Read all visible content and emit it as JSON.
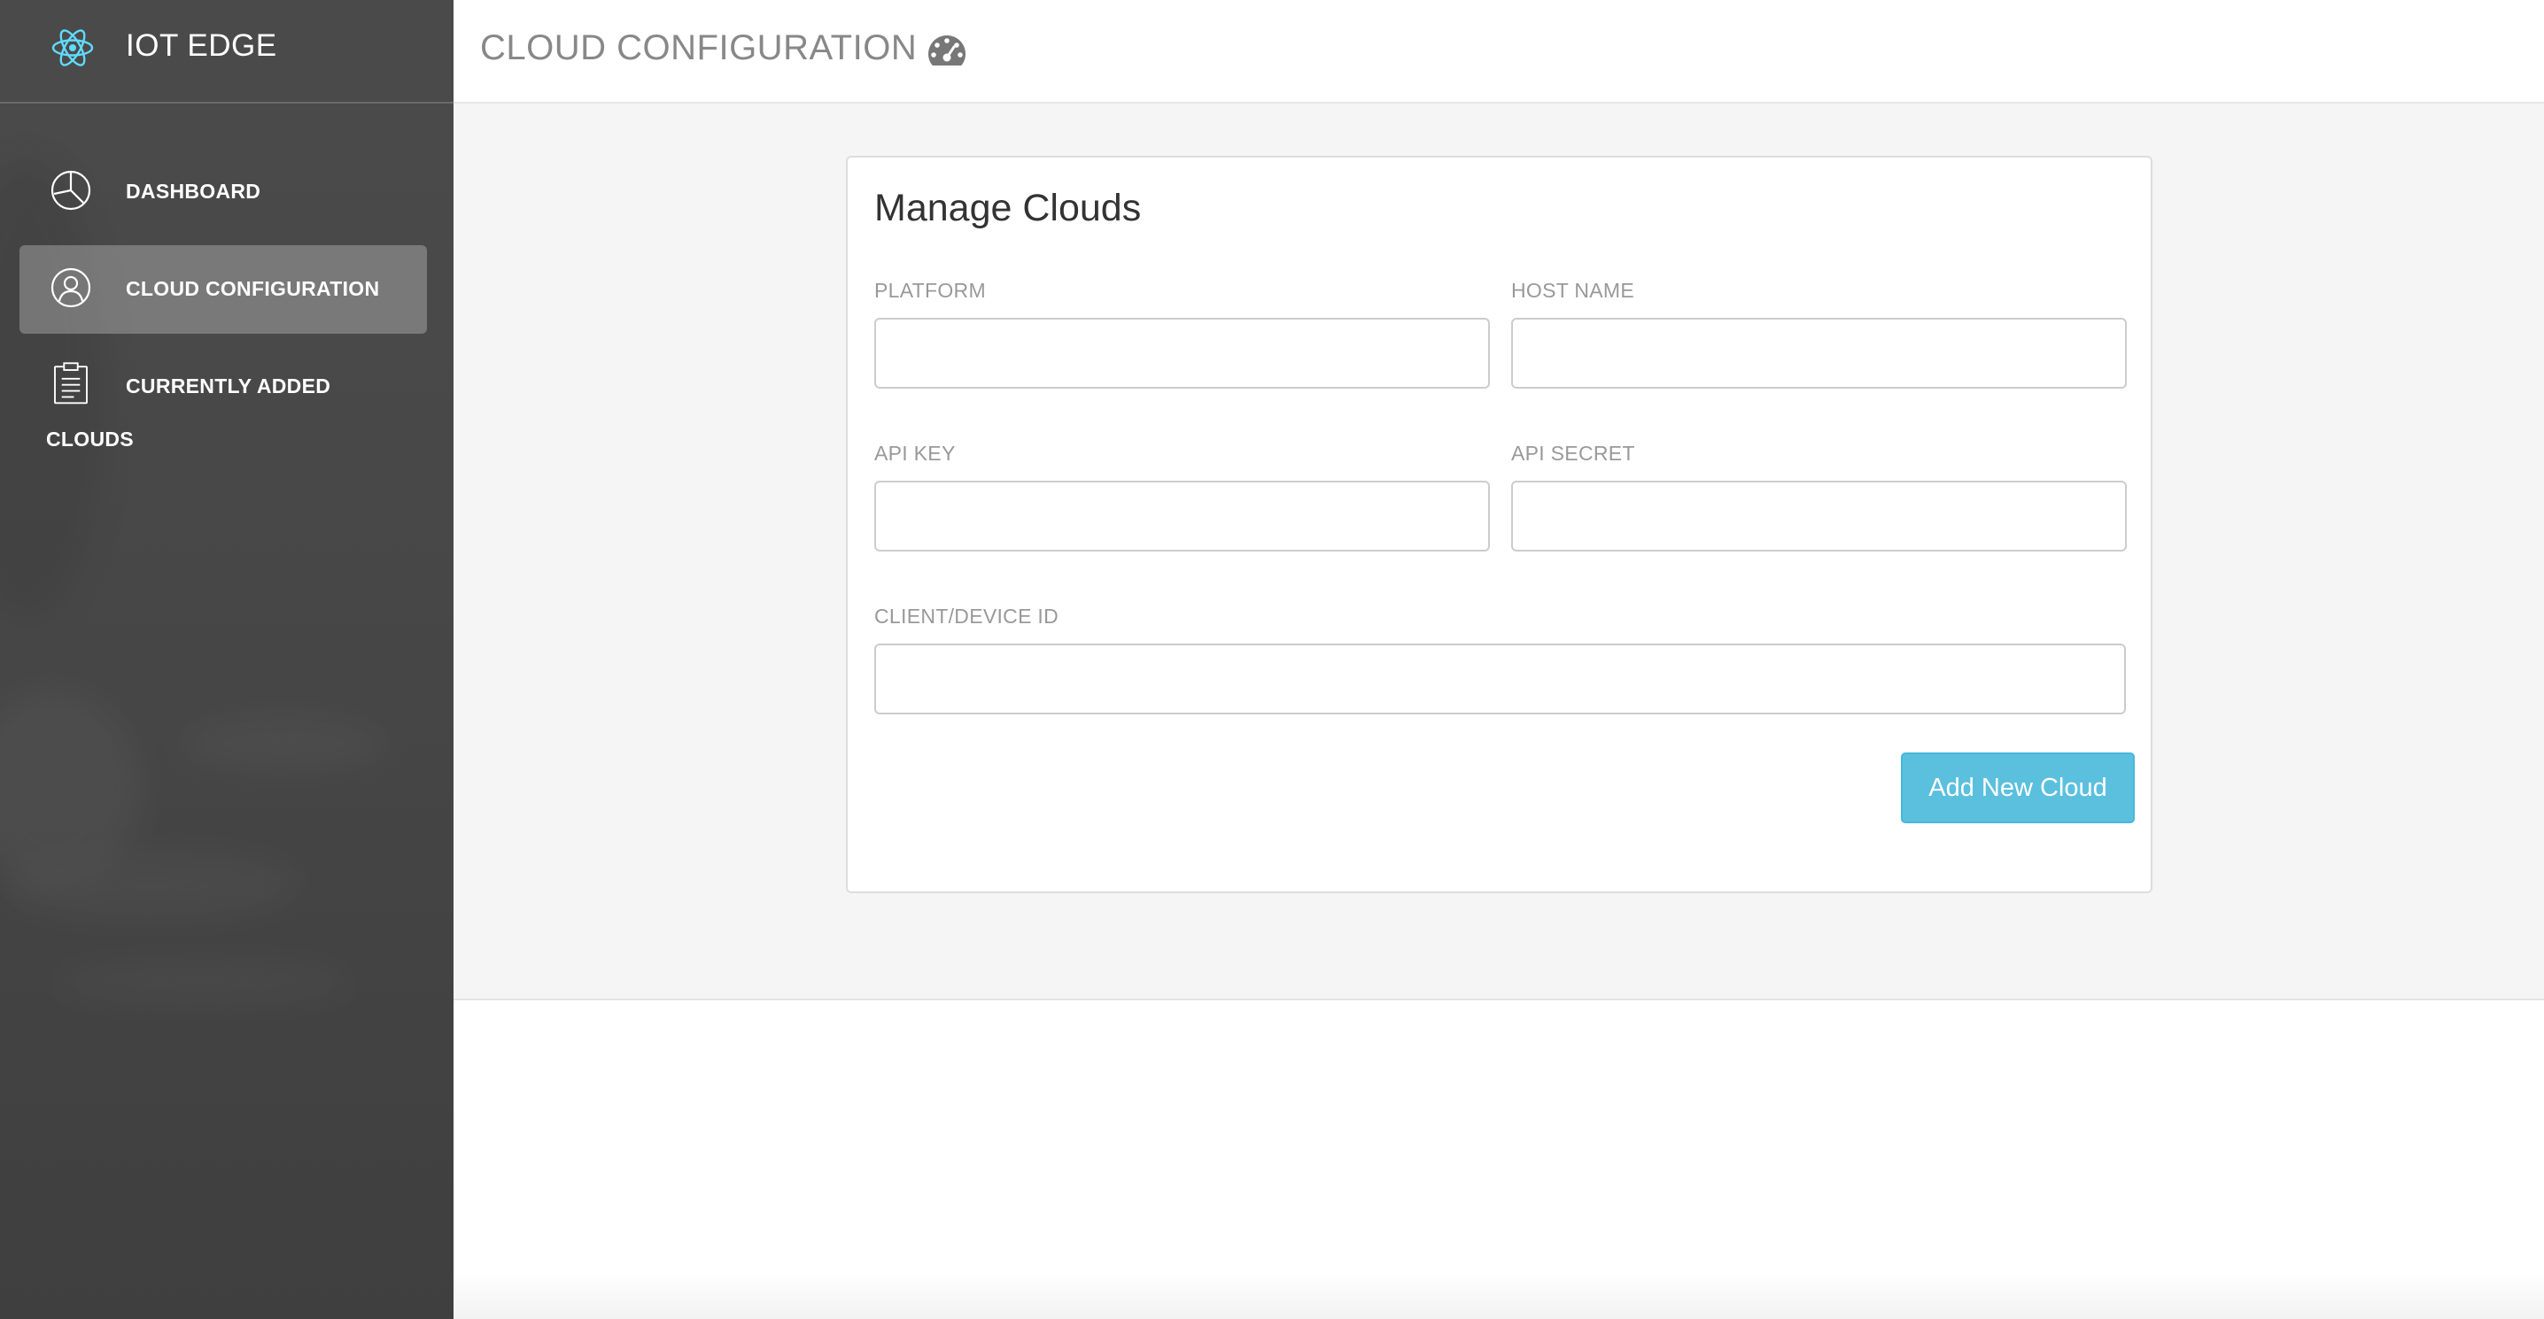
{
  "app": {
    "brand_name": "IOT EDGE",
    "brand_icon": "atom-icon",
    "accent_color": "#5bc0de"
  },
  "sidebar": {
    "items": [
      {
        "label": "DASHBOARD",
        "icon": "pie-chart-icon",
        "active": false
      },
      {
        "label": "CLOUD CONFIGURATION",
        "icon": "user-circle-icon",
        "active": true
      },
      {
        "label_line1": "CURRENTLY ADDED",
        "label_line2": "CLOUDS",
        "icon": "clipboard-icon",
        "active": false
      }
    ]
  },
  "header": {
    "title": "CLOUD CONFIGURATION",
    "icon": "dashboard-gauge-icon"
  },
  "form": {
    "title": "Manage Clouds",
    "platform_label": "PLATFORM",
    "platform_value": "",
    "host_name_label": "HOST NAME",
    "host_name_value": "",
    "api_key_label": "API KEY",
    "api_key_value": "",
    "api_secret_label": "API SECRET",
    "api_secret_value": "",
    "client_device_id_label": "CLIENT/DEVICE ID",
    "client_device_id_value": "",
    "submit_label": "Add New Cloud"
  }
}
